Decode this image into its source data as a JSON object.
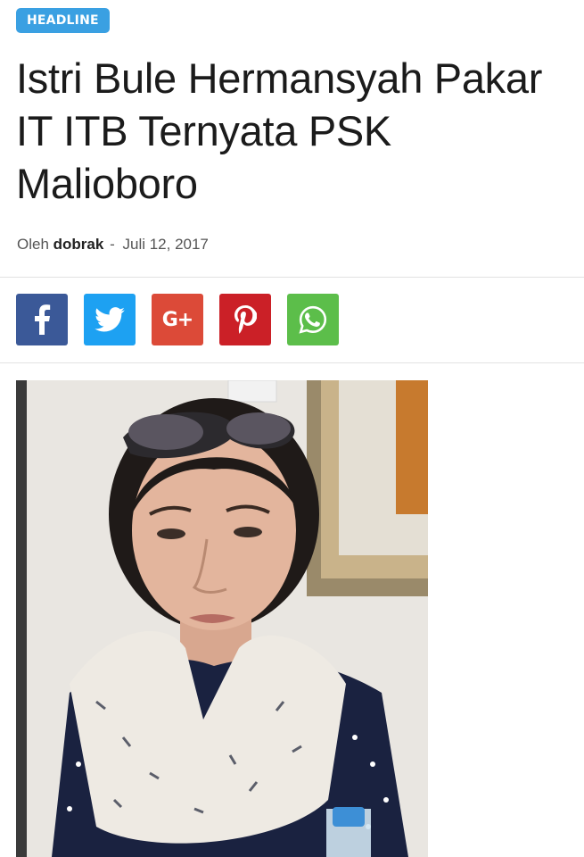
{
  "article": {
    "category": "HEADLINE",
    "title": "Istri Bule Hermansyah Pakar IT ITB Ternyata PSK Malioboro",
    "byline_prefix": "Oleh",
    "author": "dobrak",
    "separator": "-",
    "date": "Juli 12, 2017"
  },
  "share": {
    "buttons": [
      {
        "network": "facebook",
        "icon": "facebook-icon",
        "color": "#3b5998"
      },
      {
        "network": "twitter",
        "icon": "twitter-icon",
        "color": "#1da1f2"
      },
      {
        "network": "google-plus",
        "icon": "google-plus-icon",
        "label": "G+",
        "color": "#dc4a38"
      },
      {
        "network": "pinterest",
        "icon": "pinterest-icon",
        "color": "#cb2027"
      },
      {
        "network": "whatsapp",
        "icon": "whatsapp-icon",
        "color": "#5cbe4a"
      }
    ]
  },
  "colors": {
    "badge": "#3aa0e2",
    "divider": "#e2e2e2"
  }
}
